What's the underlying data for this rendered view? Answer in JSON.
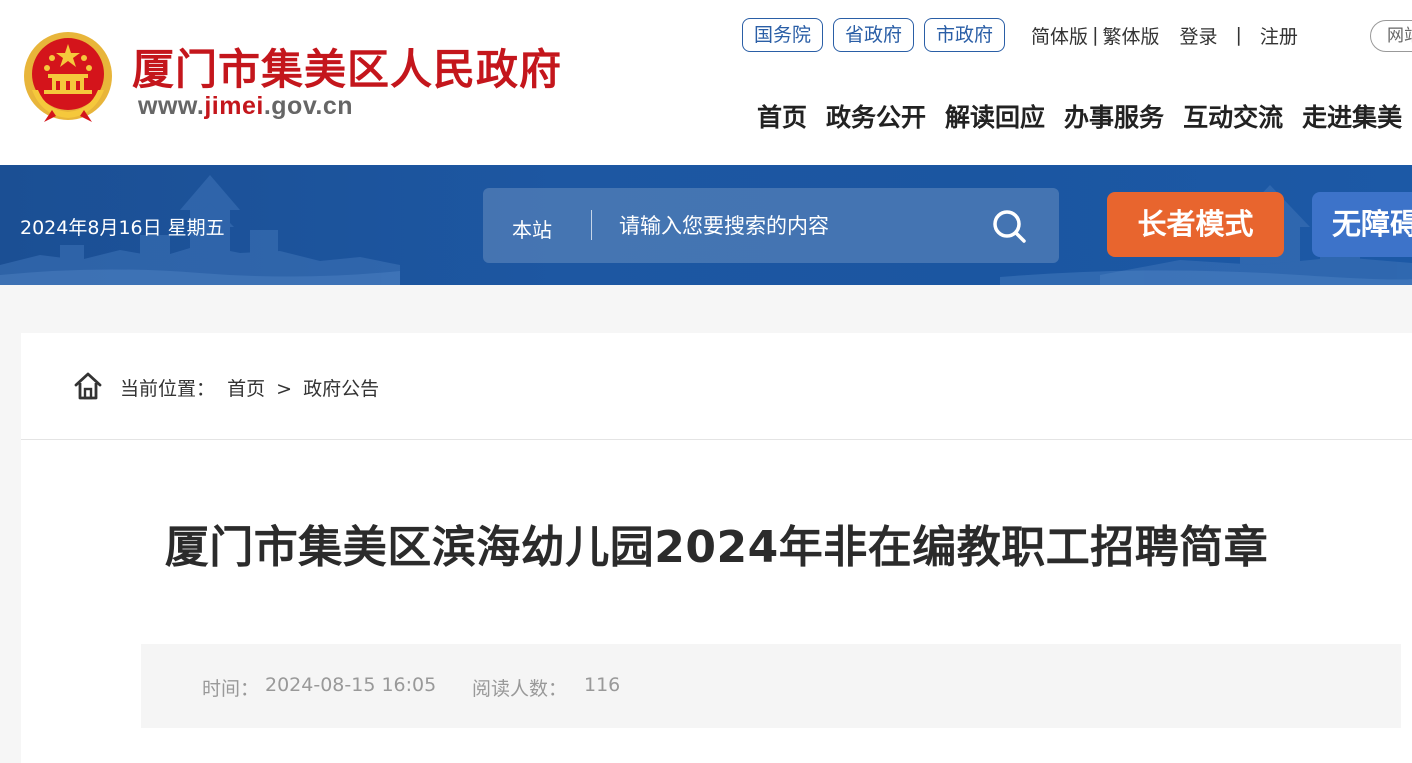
{
  "header": {
    "site_title": "厦门市集美区人民政府",
    "site_url_prefix": "www.",
    "site_url_highlight": "jimei",
    "site_url_suffix": ".gov.cn",
    "top_links": [
      "国务院",
      "省政府",
      "市政府"
    ],
    "simplified": "简体版",
    "traditional": "繁体版",
    "login": "登录",
    "register": "注册",
    "net_pill": "网站",
    "nav": [
      "首页",
      "政务公开",
      "解读回应",
      "办事服务",
      "互动交流",
      "走进集美"
    ]
  },
  "banner": {
    "date": "2024年8月16日 星期五",
    "search_scope": "本站",
    "search_placeholder": "请输入您要搜索的内容",
    "elder_mode": "长者模式",
    "accessibility": "无障碍"
  },
  "breadcrumb": {
    "label": "当前位置：",
    "home": "首页",
    "separator": ">",
    "current": "政府公告"
  },
  "article": {
    "title": "厦门市集美区滨海幼儿园2024年非在编教职工招聘简章",
    "time_label": "时间：",
    "time_value": "2024-08-15 16:05",
    "reads_label": "阅读人数：",
    "reads_value": "116"
  },
  "colors": {
    "brand_red": "#c4161c",
    "nav_blue": "#2a5ea6",
    "banner_blue": "#1d57a2",
    "elder_orange": "#e8652e"
  },
  "icons": [
    "national-emblem-icon",
    "search-icon",
    "home-icon"
  ]
}
